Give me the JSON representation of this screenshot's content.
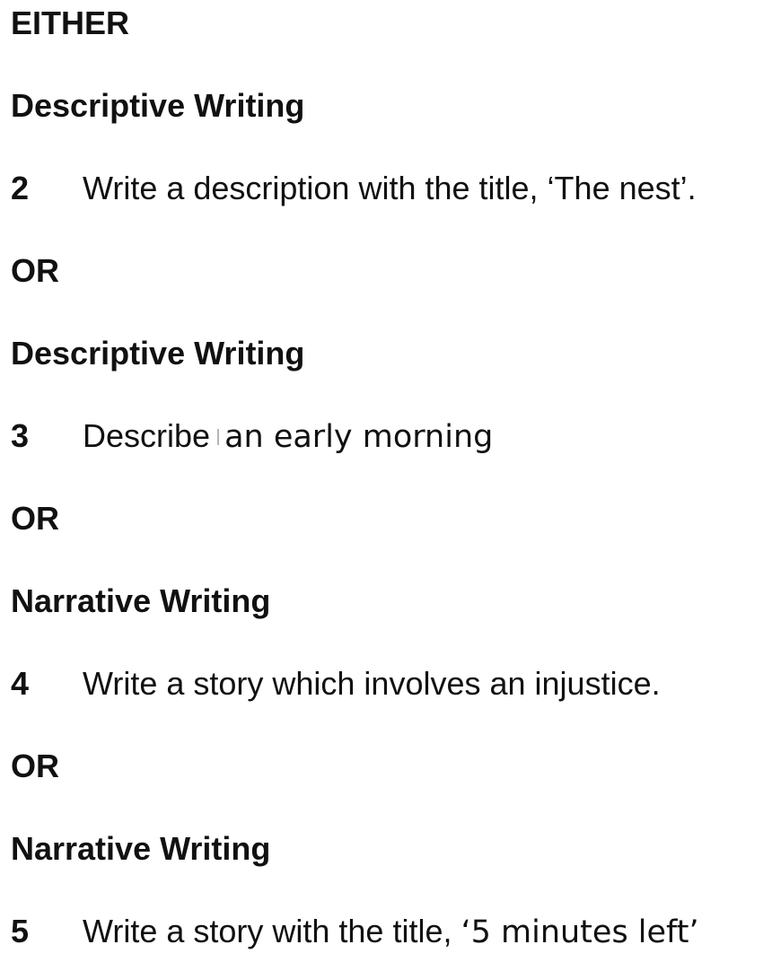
{
  "document": {
    "either_label": "EITHER",
    "sections": [
      {
        "heading": "Descriptive Writing",
        "question_number": "2",
        "question_text": "Write a description with the title, ‘The nest’."
      },
      {
        "separator": "OR",
        "heading": "Descriptive Writing",
        "question_number": "3",
        "question_text_part1": "Describe",
        "question_text_part2": "an early morning"
      },
      {
        "separator": "OR",
        "heading": "Narrative Writing",
        "question_number": "4",
        "question_text": "Write a story which involves an injustice."
      },
      {
        "separator": "OR",
        "heading": "Narrative Writing",
        "question_number": "5",
        "question_text_part1": "Write a story with the title,",
        "question_text_part2": "‘5 minutes left’"
      }
    ]
  }
}
